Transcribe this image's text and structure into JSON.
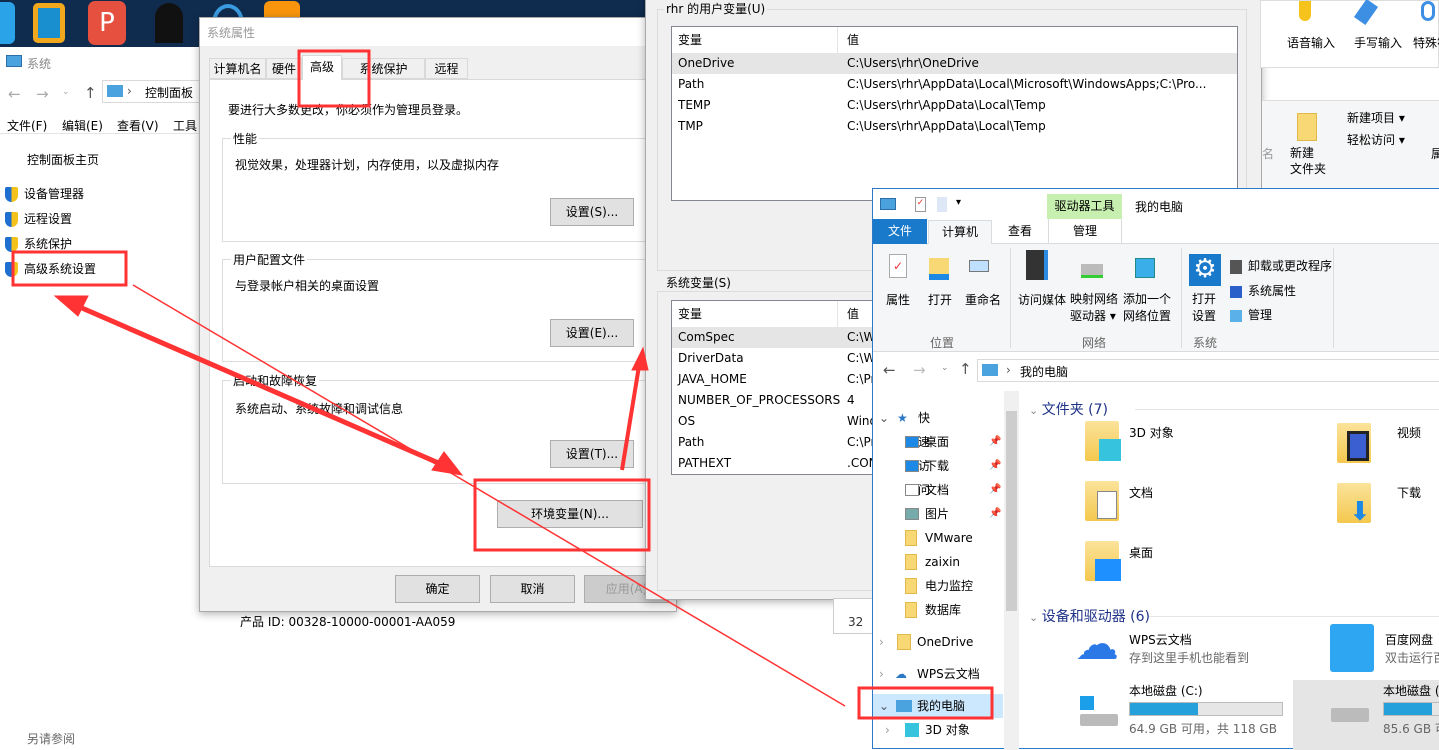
{
  "desktop": {
    "icons": [
      "app-icon-blue",
      "vmware-icon",
      "wps-pdf-icon",
      "qq-icon",
      "ie-icon",
      "app-icon-orange"
    ]
  },
  "system_window": {
    "title": "系统",
    "address": "控制面板",
    "menu": [
      "文件(F)",
      "编辑(E)",
      "查看(V)",
      "工具"
    ],
    "home_link": "控制面板主页",
    "links": [
      "设备管理器",
      "远程设置",
      "系统保护",
      "高级系统设置"
    ],
    "product_id": "产品 ID: 00328-10000-00001-AA059",
    "see_also": "另请参阅"
  },
  "sysprops": {
    "title": "系统属性",
    "tabs": [
      "计算机名",
      "硬件",
      "高级",
      "系统保护",
      "远程"
    ],
    "active_tab": "高级",
    "admin_note": "要进行大多数更改，你必须作为管理员登录。",
    "performance": {
      "label": "性能",
      "desc": "视觉效果，处理器计划，内存使用，以及虚拟内存",
      "button": "设置(S)..."
    },
    "profile": {
      "label": "用户配置文件",
      "desc": "与登录帐户相关的桌面设置",
      "button": "设置(E)..."
    },
    "startup": {
      "label": "启动和故障恢复",
      "desc": "系统启动、系统故障和调试信息",
      "button": "设置(T)..."
    },
    "env_button": "环境变量(N)...",
    "ok": "确定",
    "cancel": "取消",
    "apply": "应用(A)"
  },
  "envvars": {
    "user_label": "rhr 的用户变量(U)",
    "col_var": "变量",
    "col_val": "值",
    "user_rows": [
      {
        "name": "OneDrive",
        "value": "C:\\Users\\rhr\\OneDrive"
      },
      {
        "name": "Path",
        "value": "C:\\Users\\rhr\\AppData\\Local\\Microsoft\\WindowsApps;C:\\Pro..."
      },
      {
        "name": "TEMP",
        "value": "C:\\Users\\rhr\\AppData\\Local\\Temp"
      },
      {
        "name": "TMP",
        "value": "C:\\Users\\rhr\\AppData\\Local\\Temp"
      }
    ],
    "system_label": "系统变量(S)",
    "system_rows": [
      {
        "name": "ComSpec",
        "value": "C:\\W"
      },
      {
        "name": "DriverData",
        "value": "C:\\W"
      },
      {
        "name": "JAVA_HOME",
        "value": "C:\\Pr"
      },
      {
        "name": "NUMBER_OF_PROCESSORS",
        "value": "4"
      },
      {
        "name": "OS",
        "value": "Wind"
      },
      {
        "name": "Path",
        "value": "C:\\Pr"
      },
      {
        "name": "PATHEXT",
        "value": ".CON"
      }
    ]
  },
  "ime": {
    "items": [
      "语音输入",
      "手写输入",
      "特殊符"
    ]
  },
  "bg_ribbon": {
    "new_item": "新建项目 ▾",
    "easy_access": "轻松访问 ▾",
    "new_folder": "新建\n文件夹",
    "partial_left": "名",
    "partial_right": "属"
  },
  "small_panel": {
    "text": "32"
  },
  "explorer": {
    "title": "我的电脑",
    "context_tab": "驱动器工具",
    "tabs": [
      "文件",
      "计算机",
      "查看",
      "管理"
    ],
    "active_tab": "计算机",
    "ribbon": {
      "location": {
        "label": "位置",
        "items": [
          "属性",
          "打开",
          "重命名"
        ]
      },
      "network": {
        "label": "网络",
        "items": [
          "访问媒体",
          "映射网络\n驱动器 ▾",
          "添加一个\n网络位置"
        ]
      },
      "system": {
        "label": "系统",
        "open_settings": "打开\n设置",
        "items": [
          "卸载或更改程序",
          "系统属性",
          "管理"
        ]
      }
    },
    "address": "我的电脑",
    "nav": {
      "quick_access": "快速访问",
      "pinned": [
        "桌面",
        "下载",
        "文档",
        "图片"
      ],
      "folders": [
        "VMware",
        "zaixin",
        "电力监控",
        "数据库"
      ],
      "onedrive": "OneDrive",
      "wps": "WPS云文档",
      "this_pc": "我的电脑",
      "sub": "3D 对象"
    },
    "folders_header": "文件夹 (7)",
    "folders": [
      "3D 对象",
      "视频",
      "文档",
      "下载",
      "桌面"
    ],
    "devices_header": "设备和驱动器 (6)",
    "wps": {
      "name": "WPS云文档",
      "desc": "存到这里手机也能看到"
    },
    "baidu": {
      "name": "百度网盘",
      "desc": "双击运行百"
    },
    "drive_c": {
      "name": "本地磁盘 (C:)",
      "free": "64.9 GB 可用，共 118 GB",
      "used_fraction": 0.45
    },
    "drive_d": {
      "name": "本地磁盘 (",
      "free": "85.6 GB 可",
      "used_fraction": 0.3
    }
  },
  "colors": {
    "annotation": "#ff3333",
    "accent": "#1979ca",
    "context_tab": "#c6efb0",
    "drive_bar": "#26a0da"
  }
}
